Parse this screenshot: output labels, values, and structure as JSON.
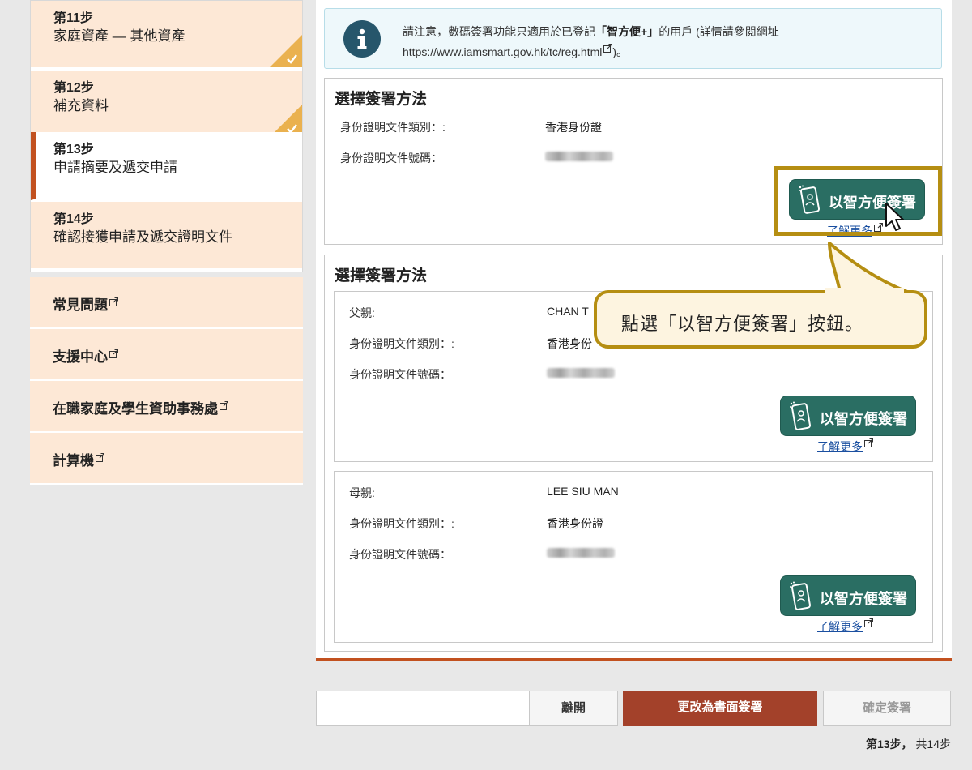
{
  "sidebar": {
    "steps": [
      {
        "num": "第11步",
        "title": "家庭資產 — 其他資產",
        "completed": true,
        "active": false
      },
      {
        "num": "第12步",
        "title": "補充資料",
        "completed": true,
        "active": false
      },
      {
        "num": "第13步",
        "title": "申請摘要及遞交申請",
        "completed": false,
        "active": true
      },
      {
        "num": "第14步",
        "title": "確認接獲申請及遞交證明文件",
        "completed": false,
        "active": false
      }
    ],
    "links": [
      {
        "label": "常見問題"
      },
      {
        "label": "支援中心"
      },
      {
        "label": "在職家庭及學生資助事務處"
      },
      {
        "label": "計算機"
      }
    ]
  },
  "notice": {
    "text_before": "請注意，數碼簽署功能只適用於已登記",
    "highlight": "「智方便+」",
    "text_after": "的用戶 (詳情請參閱網址",
    "url": "https://www.iamsmart.gov.hk/tc/reg.html",
    "text_end": ")。"
  },
  "panel1": {
    "title": "選擇簽署方法",
    "doc_type_label": "身份證明文件類別：:",
    "doc_type_value": "香港身份證",
    "doc_no_label": "身份證明文件號碼：",
    "button_label": "以智方便簽署",
    "learn_more": "了解更多"
  },
  "panel2": {
    "title": "選擇簽署方法",
    "father": {
      "role_label": "父親:",
      "name": "CHAN T",
      "doc_type_label": "身份證明文件類別：:",
      "doc_type_value": "香港身份",
      "doc_no_label": "身份證明文件號碼：",
      "button_label": "以智方便簽署",
      "learn_more": "了解更多"
    },
    "mother": {
      "role_label": "母親:",
      "name": "LEE SIU MAN",
      "doc_type_label": "身份證明文件類別：:",
      "doc_type_value": "香港身份證",
      "doc_no_label": "身份證明文件號碼：",
      "button_label": "以智方便簽署",
      "learn_more": "了解更多"
    }
  },
  "callout": {
    "text": "點選「以智方便簽署」按鈕。"
  },
  "footer": {
    "leave": "離開",
    "paper_sign": "更改為書面簽署",
    "confirm_sign": "確定簽署",
    "step_current": "第13步，",
    "step_total": "共14步"
  },
  "colors": {
    "accent": "#c2511f",
    "iamsmart": "#2a6e63",
    "highlight_border": "#b58e12",
    "step_bg": "#fde8d6",
    "paper_btn": "#a3412a"
  },
  "icons": [
    "check-icon",
    "external-link-icon",
    "info-icon",
    "iamsmart-phone-icon",
    "mouse-cursor-icon"
  ]
}
